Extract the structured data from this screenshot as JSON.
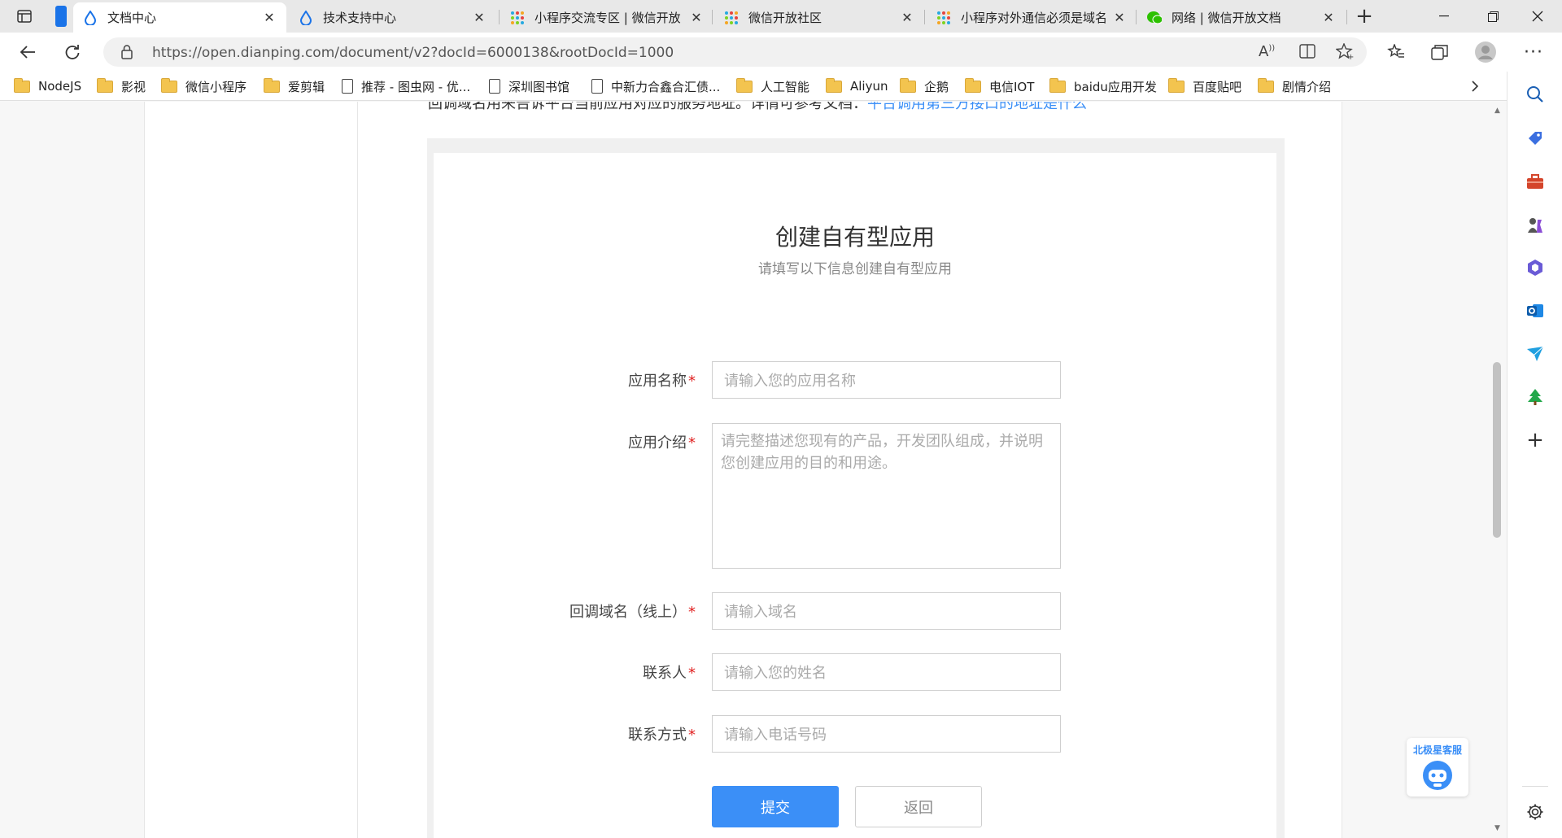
{
  "browser": {
    "tabs": [
      {
        "title": "文档中心",
        "active": true
      },
      {
        "title": "技术支持中心",
        "active": false
      },
      {
        "title": "小程序交流专区 | 微信开放",
        "active": false
      },
      {
        "title": "微信开放社区",
        "active": false
      },
      {
        "title": "小程序对外通信必须是域名",
        "active": false
      },
      {
        "title": "网络 | 微信开放文档",
        "active": false
      }
    ],
    "url": "https://open.dianping.com/document/v2?docId=6000138&rootDocId=1000",
    "bookmarks": [
      {
        "label": "NodeJS",
        "type": "folder"
      },
      {
        "label": "影视",
        "type": "folder"
      },
      {
        "label": "微信小程序",
        "type": "folder"
      },
      {
        "label": "爱剪辑",
        "type": "folder"
      },
      {
        "label": "推荐 - 图虫网 - 优...",
        "type": "page"
      },
      {
        "label": "深圳图书馆",
        "type": "page"
      },
      {
        "label": "中新力合鑫合汇债...",
        "type": "page"
      },
      {
        "label": "人工智能",
        "type": "folder"
      },
      {
        "label": "Aliyun",
        "type": "folder"
      },
      {
        "label": "企鹅",
        "type": "folder"
      },
      {
        "label": "电信IOT",
        "type": "folder"
      },
      {
        "label": "baidu应用开发",
        "type": "folder"
      },
      {
        "label": "百度贴吧",
        "type": "folder"
      },
      {
        "label": "剧情介绍",
        "type": "folder"
      }
    ]
  },
  "page": {
    "intro_text": "回调域名用来告诉平台当前应用对应的服务地址。详情可参考文档：",
    "intro_link": "平台调用第三方接口的地址是什么",
    "form": {
      "title": "创建自有型应用",
      "subtitle": "请填写以下信息创建自有型应用",
      "required_mark": "*",
      "fields": [
        {
          "label": "应用名称",
          "placeholder": "请输入您的应用名称"
        },
        {
          "label": "应用介绍",
          "placeholder": "请完整描述您现有的产品，开发团队组成，并说明您创建应用的目的和用途。"
        },
        {
          "label": "回调域名（线上）",
          "placeholder": "请输入域名"
        },
        {
          "label": "联系人",
          "placeholder": "请输入您的姓名"
        },
        {
          "label": "联系方式",
          "placeholder": "请输入电话号码"
        }
      ],
      "submit_label": "提交",
      "back_label": "返回"
    },
    "helper_label": "北极星客服"
  },
  "colors": {
    "accent": "#3b8ff7",
    "required": "#e02020"
  }
}
